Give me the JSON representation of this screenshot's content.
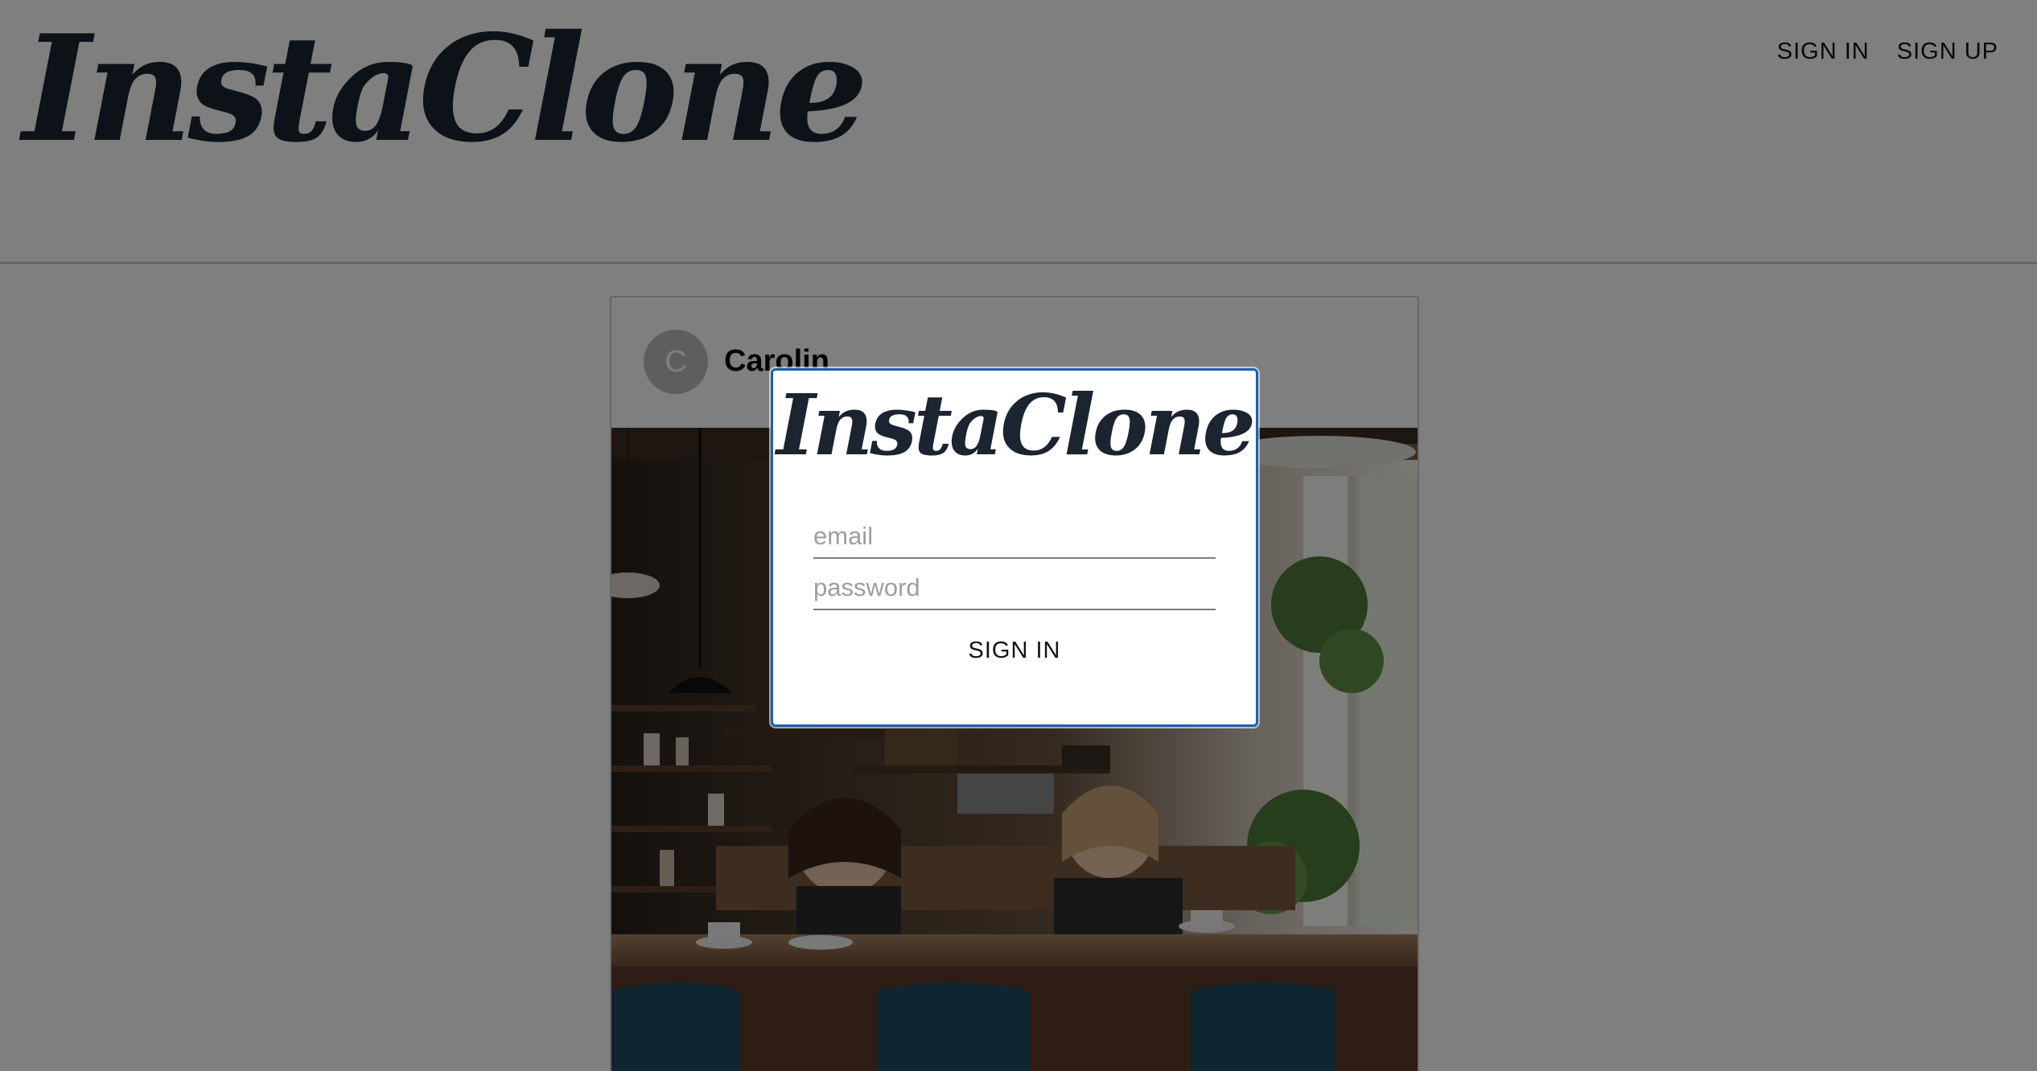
{
  "app": {
    "logo_text": "InstaClone"
  },
  "nav": {
    "sign_in": "SIGN IN",
    "sign_up": "SIGN UP"
  },
  "post": {
    "avatar_initial": "C",
    "username": "Carolin"
  },
  "modal": {
    "logo_text": "InstaClone",
    "email_placeholder": "email",
    "password_placeholder": "password",
    "submit_label": "SIGN IN"
  },
  "colors": {
    "logo": "#1b2430",
    "modal_border": "#1e5fb3",
    "backdrop": "rgba(0,0,0,0.5)"
  }
}
